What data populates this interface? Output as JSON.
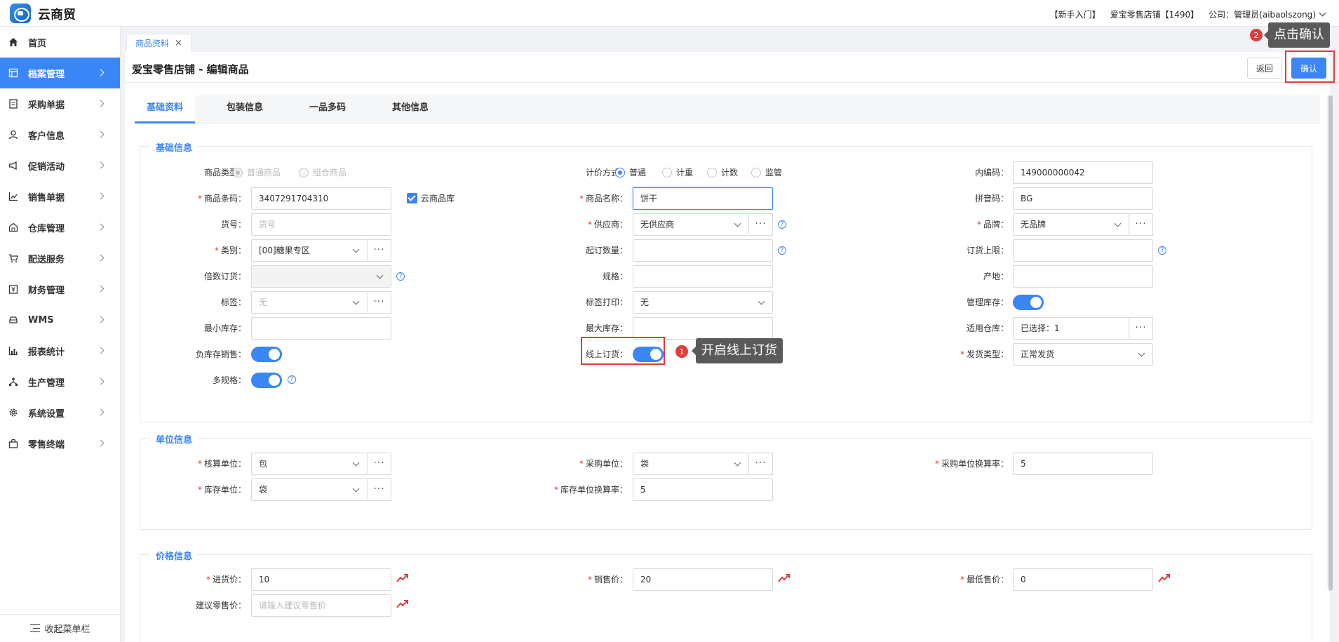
{
  "app": {
    "title": "云商贸"
  },
  "topbar": {
    "guide": "【新手入门】",
    "store": "爱宝零售店铺【1490】",
    "company": "公司：管理员(aibaolszong)"
  },
  "sidebar": {
    "items": [
      {
        "label": "首页",
        "icon": "home-icon"
      },
      {
        "label": "档案管理",
        "icon": "archive-icon"
      },
      {
        "label": "采购单据",
        "icon": "document-icon"
      },
      {
        "label": "客户信息",
        "icon": "user-icon"
      },
      {
        "label": "促销活动",
        "icon": "megaphone-icon"
      },
      {
        "label": "销售单据",
        "icon": "trend-chart-icon"
      },
      {
        "label": "仓库管理",
        "icon": "warehouse-icon"
      },
      {
        "label": "配送服务",
        "icon": "cart-icon"
      },
      {
        "label": "财务管理",
        "icon": "finance-icon"
      },
      {
        "label": "WMS",
        "icon": "car-icon"
      },
      {
        "label": "报表统计",
        "icon": "bar-chart-icon"
      },
      {
        "label": "生产管理",
        "icon": "network-icon"
      },
      {
        "label": "系统设置",
        "icon": "gear-icon"
      },
      {
        "label": "零售终端",
        "icon": "bag-icon"
      }
    ],
    "collapse_label": "收起菜单栏"
  },
  "tab": {
    "label": "商品资料",
    "close": "×"
  },
  "page": {
    "title": "爱宝零售店铺 - 编辑商品",
    "back_label": "返回",
    "confirm_label": "确认"
  },
  "annotations": {
    "step1_num": "1",
    "step1_text": "开启线上订货",
    "step2_num": "2",
    "step2_text": "点击确认"
  },
  "inner_tabs": [
    "基础资料",
    "包装信息",
    "一品多码",
    "其他信息"
  ],
  "basic": {
    "title": "基础信息",
    "product_type_label": "商品类型：",
    "product_type_options": [
      "普通商品",
      "组合商品"
    ],
    "pricing_label": "计价方式：",
    "pricing_options": [
      "普通",
      "计重",
      "计数",
      "监管"
    ],
    "inner_code_label": "内编码：",
    "inner_code": "149000000042",
    "barcode_label": "商品条码：",
    "barcode": "3407291704310",
    "cloud_lib_label": "云商品库",
    "name_label": "商品名称：",
    "name": "饼干",
    "pinyin_label": "拼音码：",
    "pinyin": "BG",
    "item_no_label": "货号：",
    "item_no_placeholder": "货号",
    "supplier_label": "供应商：",
    "supplier": "无供应商",
    "brand_label": "品牌：",
    "brand": "无品牌",
    "category_label": "类别：",
    "category": "[00]糖果专区",
    "min_order_label": "起订数量：",
    "order_limit_label": "订货上限：",
    "multiple_label": "倍数订货：",
    "spec_label": "规格：",
    "origin_label": "产地：",
    "tag_label": "标签：",
    "tag": "无",
    "tag_print_label": "标签打印：",
    "tag_print": "无",
    "manage_stock_label": "管理库存：",
    "min_stock_label": "最小库存：",
    "max_stock_label": "最大库存：",
    "warehouse_label": "适用仓库：",
    "warehouse": "已选择：1",
    "negative_label": "负库存销售：",
    "online_label": "线上订货：",
    "ship_type_label": "发货类型：",
    "ship_type": "正常发货",
    "multi_spec_label": "多规格："
  },
  "unit": {
    "title": "单位信息",
    "accounting_label": "核算单位：",
    "accounting": "包",
    "purchase_label": "采购单位：",
    "purchase": "袋",
    "purchase_rate_label": "采购单位换算率：",
    "purchase_rate": "5",
    "stock_label": "库存单位：",
    "stock": "袋",
    "stock_rate_label": "库存单位换算率：",
    "stock_rate": "5"
  },
  "price": {
    "title": "价格信息",
    "cost_label": "进货价：",
    "cost": "10",
    "sale_label": "销售价：",
    "sale": "20",
    "lowest_label": "最低售价：",
    "lowest": "0",
    "retail_label": "建议零售价：",
    "retail_placeholder": "请输入建议零售价"
  },
  "help_glyph": "?",
  "more_glyph": "···",
  "colors": {
    "accent": "#3b86f7",
    "highlight": "#e23b3b"
  }
}
